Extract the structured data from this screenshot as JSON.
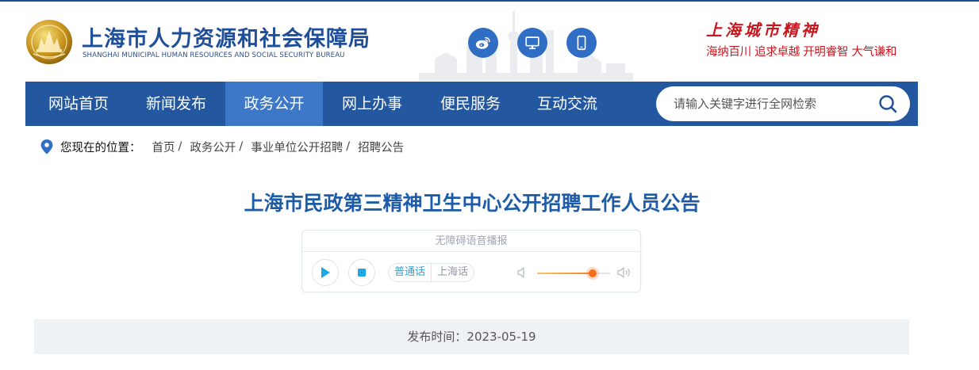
{
  "header": {
    "org_name_cn": "上海市人力资源和社会保障局",
    "org_name_en": "SHANGHAI MUNICIPAL HUMAN RESOURCES AND SOCIAL SECURITY BUREAU",
    "social_icons": [
      "weibo-icon",
      "desktop-icon",
      "mobile-icon"
    ],
    "motto_title": "上海城市精神",
    "motto_line": "海纳百川  追求卓越  开明睿智  大气谦和"
  },
  "nav": {
    "items": [
      {
        "label": "网站首页"
      },
      {
        "label": "新闻发布"
      },
      {
        "label": "政务公开",
        "active": true
      },
      {
        "label": "网上办事"
      },
      {
        "label": "便民服务"
      },
      {
        "label": "互动交流"
      }
    ],
    "search_placeholder": "请输入关键字进行全网检索"
  },
  "breadcrumb": {
    "label": "您现在的位置：",
    "items": [
      "首页",
      "政务公开",
      "事业单位公开招聘",
      "招聘公告"
    ],
    "separator": "/"
  },
  "article": {
    "title": "上海市民政第三精神卫生中心公开招聘工作人员公告",
    "publish_time": "发布时间：2023-05-19"
  },
  "player": {
    "title": "无障碍语音播报",
    "languages": [
      "普通话",
      "上海话"
    ],
    "selected_language": "普通话",
    "volume": 0.76
  },
  "colors": {
    "nav_bg": "#23579f",
    "nav_active": "#3c77c8",
    "title": "#1f5ca8",
    "motto": "#d0161f"
  }
}
